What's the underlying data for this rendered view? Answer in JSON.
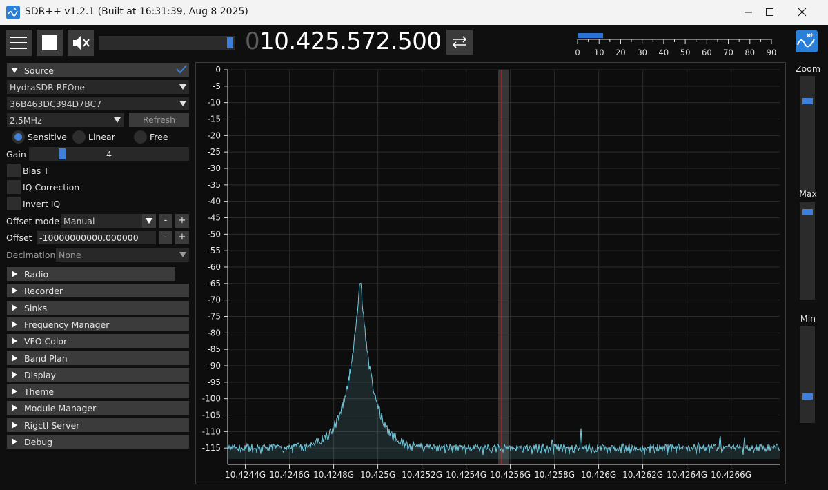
{
  "window": {
    "title": "SDR++ v1.2.1 (Built at 16:31:39, Aug  8 2025)",
    "controls": [
      "minimize-icon",
      "maximize-icon",
      "close-icon"
    ]
  },
  "toolbar": {
    "menu_icon": "hamburger-icon",
    "stop_icon": "stop-square-icon",
    "mute_icon": "speaker-muted-icon",
    "volume": 0.95,
    "frequency_lead": "0",
    "frequency_main": "10.425.572.500",
    "swap_icon": "swap-arrows-icon",
    "snr_scale": [
      "0",
      "10",
      "20",
      "30",
      "40",
      "50",
      "60",
      "70",
      "80",
      "90"
    ],
    "snr_level": 12,
    "logo_icon": "sdrpp-logo-icon"
  },
  "source": {
    "header": "Source",
    "device": "HydraSDR RFOne",
    "serial": "36B463DC394D7BC7",
    "samplerate": "2.5MHz",
    "refresh_label": "Refresh",
    "gain_modes": [
      "Sensitive",
      "Linear",
      "Free"
    ],
    "gain_mode_selected": "Sensitive",
    "gain_label": "Gain",
    "gain_value": "4",
    "bias_t_label": "Bias T",
    "iq_correction_label": "IQ Correction",
    "invert_iq_label": "Invert IQ",
    "offset_mode_label": "Offset mode",
    "offset_mode_value": "Manual",
    "offset_label": "Offset",
    "offset_value": "-10000000000.000000",
    "decimation_label": "Decimation",
    "decimation_value": "None",
    "minus": "-",
    "plus": "+"
  },
  "menu": [
    {
      "label": "Radio",
      "checked": true
    },
    {
      "label": "Recorder"
    },
    {
      "label": "Sinks"
    },
    {
      "label": "Frequency Manager"
    },
    {
      "label": "VFO Color"
    },
    {
      "label": "Band Plan"
    },
    {
      "label": "Display"
    },
    {
      "label": "Theme"
    },
    {
      "label": "Module Manager"
    },
    {
      "label": "Rigctl Server"
    },
    {
      "label": "Debug"
    }
  ],
  "chart_data": {
    "type": "line",
    "y_ticks": [
      "0",
      "-5",
      "-10",
      "-15",
      "-20",
      "-25",
      "-30",
      "-35",
      "-40",
      "-45",
      "-50",
      "-55",
      "-60",
      "-65",
      "-70",
      "-75",
      "-80",
      "-85",
      "-90",
      "-95",
      "-100",
      "-105",
      "-110",
      "-115"
    ],
    "x_ticks": [
      "10.4244G",
      "10.4246G",
      "10.4248G",
      "10.425G",
      "10.4252G",
      "10.4254G",
      "10.4256G",
      "10.4258G",
      "10.426G",
      "10.4262G",
      "10.4264G",
      "10.4266G"
    ],
    "ylim": [
      -120,
      0
    ],
    "xlim_ghz": [
      10.42432,
      10.42682
    ],
    "noise_floor_db": -116,
    "peak": {
      "freq_ghz": 10.42492,
      "db": -65
    },
    "vfo_freq_ghz": 10.42557,
    "small_spurs": [
      {
        "freq_ghz": 10.42579,
        "db": -111
      },
      {
        "freq_ghz": 10.42592,
        "db": -109
      },
      {
        "freq_ghz": 10.42655,
        "db": -110
      },
      {
        "freq_ghz": 10.42666,
        "db": -111
      },
      {
        "freq_ghz": 10.42645,
        "db": -112
      }
    ],
    "grid": true
  },
  "right_sliders": {
    "zoom_label": "Zoom",
    "zoom_value": 0.8,
    "max_label": "Max",
    "max_value": 0.92,
    "min_label": "Min",
    "min_value": 0.26
  }
}
